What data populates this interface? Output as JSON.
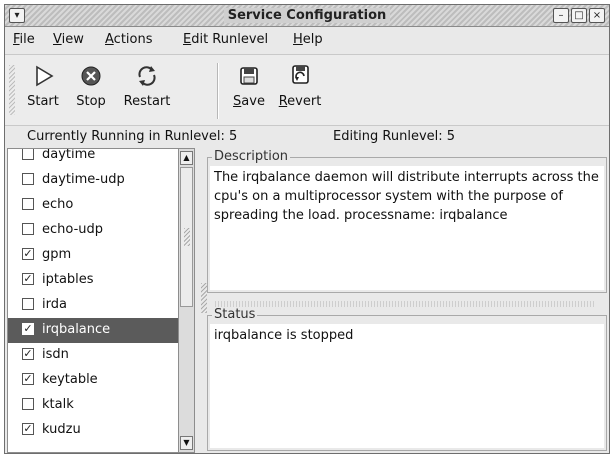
{
  "window": {
    "title": "Service Configuration",
    "controls": {
      "minimize": "–",
      "maximize": "□",
      "close": "×"
    }
  },
  "menu": [
    {
      "label": "File",
      "accel": "F",
      "rest": "ile"
    },
    {
      "label": "View",
      "accel": "V",
      "rest": "iew"
    },
    {
      "label": "Actions",
      "accel": "A",
      "rest": "ctions"
    },
    {
      "label": "Edit Runlevel",
      "accel": "E",
      "rest": "dit Runlevel"
    },
    {
      "label": "Help",
      "accel": "H",
      "rest": "elp"
    }
  ],
  "toolbar": {
    "start": {
      "label": "Start",
      "icon": "play-icon"
    },
    "stop": {
      "label": "Stop",
      "icon": "stop-circle-icon"
    },
    "restart": {
      "label": "Restart",
      "icon": "restart-icon"
    },
    "save": {
      "label": "Save",
      "accel": "S",
      "rest": "ave",
      "icon": "save-icon"
    },
    "revert": {
      "label": "Revert",
      "accel": "R",
      "rest": "evert",
      "icon": "revert-icon"
    }
  },
  "status_line": {
    "running": "Currently Running in Runlevel: 5",
    "editing": "Editing Runlevel: 5"
  },
  "services": [
    {
      "name": "daytime",
      "checked": false
    },
    {
      "name": "daytime-udp",
      "checked": false
    },
    {
      "name": "echo",
      "checked": false
    },
    {
      "name": "echo-udp",
      "checked": false
    },
    {
      "name": "gpm",
      "checked": true
    },
    {
      "name": "iptables",
      "checked": true
    },
    {
      "name": "irda",
      "checked": false
    },
    {
      "name": "irqbalance",
      "checked": true,
      "selected": true
    },
    {
      "name": "isdn",
      "checked": true
    },
    {
      "name": "keytable",
      "checked": true
    },
    {
      "name": "ktalk",
      "checked": false
    },
    {
      "name": "kudzu",
      "checked": true
    }
  ],
  "description": {
    "title": "Description",
    "text": "The irqbalance daemon will distribute interrupts across the cpu's on a multiprocessor system with the purpose of spreading the load. processname: irqbalance"
  },
  "status": {
    "title": "Status",
    "text": "irqbalance is stopped"
  }
}
